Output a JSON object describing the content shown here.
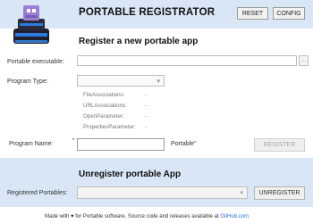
{
  "header": {
    "title": "PORTABLE REGISTRATOR",
    "reset_label": "RESET",
    "config_label": "CONFIG"
  },
  "register": {
    "section_title": "Register a new portable app",
    "executable_label": "Portable executable:",
    "executable_value": "",
    "browse_label": "...",
    "program_type_label": "Program Type:",
    "program_type_value": "",
    "properties": [
      {
        "name": "FileAssociations:",
        "value": "-"
      },
      {
        "name": "URLAssociations:",
        "value": "-"
      },
      {
        "name": "OpenParameter:",
        "value": "-"
      },
      {
        "name": "PropertiesParameter:",
        "value": "-"
      }
    ],
    "program_name_label": "Program Name:",
    "program_name_prefix": "\"",
    "program_name_value": "",
    "program_name_suffix": "Portable\"",
    "register_label": "REGISTER"
  },
  "unregister": {
    "section_title": "Unregister portable App",
    "registered_label": "Registered Portables:",
    "registered_value": "",
    "unregister_label": "UNREGISTER"
  },
  "footer": {
    "text": "Made with ♥ for Portable software. Source code and releases available at ",
    "link": "GitHub.com"
  },
  "colors": {
    "panel_bg": "#d9e6f6",
    "link": "#2a6fd6",
    "logo_accent": "#2d7be0"
  },
  "icons": {
    "logo": "usb-stick-logo-icon",
    "dropdown": "chevron-down-icon"
  }
}
